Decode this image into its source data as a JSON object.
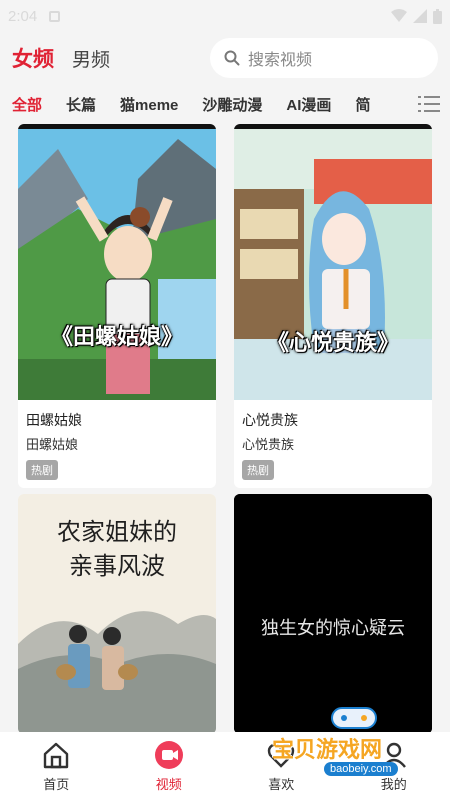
{
  "status_bar": {
    "time": "2:04"
  },
  "header": {
    "tabs": [
      {
        "label": "女频",
        "active": true
      },
      {
        "label": "男频",
        "active": false
      }
    ],
    "search": {
      "placeholder": "搜索视频"
    }
  },
  "categories": [
    "全部",
    "长篇",
    "猫meme",
    "沙雕动漫",
    "AI漫画",
    "简"
  ],
  "cards": [
    {
      "poster_text": "《田螺姑娘》",
      "title": "田螺姑娘",
      "subtitle": "田螺姑娘",
      "tag": "热剧"
    },
    {
      "poster_text": "《心悦贵族》",
      "title": "心悦贵族",
      "subtitle": "心悦贵族",
      "tag": "热剧"
    },
    {
      "poster_text_line1": "农家姐妹的",
      "poster_text_line2": "亲事风波"
    },
    {
      "poster_text": "独生女的惊心疑云"
    }
  ],
  "bottom_nav": [
    {
      "label": "首页",
      "icon": "home-icon",
      "active": false
    },
    {
      "label": "视频",
      "icon": "video-icon",
      "active": true
    },
    {
      "label": "喜欢",
      "icon": "heart-icon",
      "active": false
    },
    {
      "label": "我的",
      "icon": "profile-icon",
      "active": false
    }
  ],
  "watermark": {
    "text": "宝贝游戏网",
    "url": "baobeiy.com"
  },
  "colors": {
    "accent": "#e02234",
    "tag_bg": "#a6a6a6"
  }
}
